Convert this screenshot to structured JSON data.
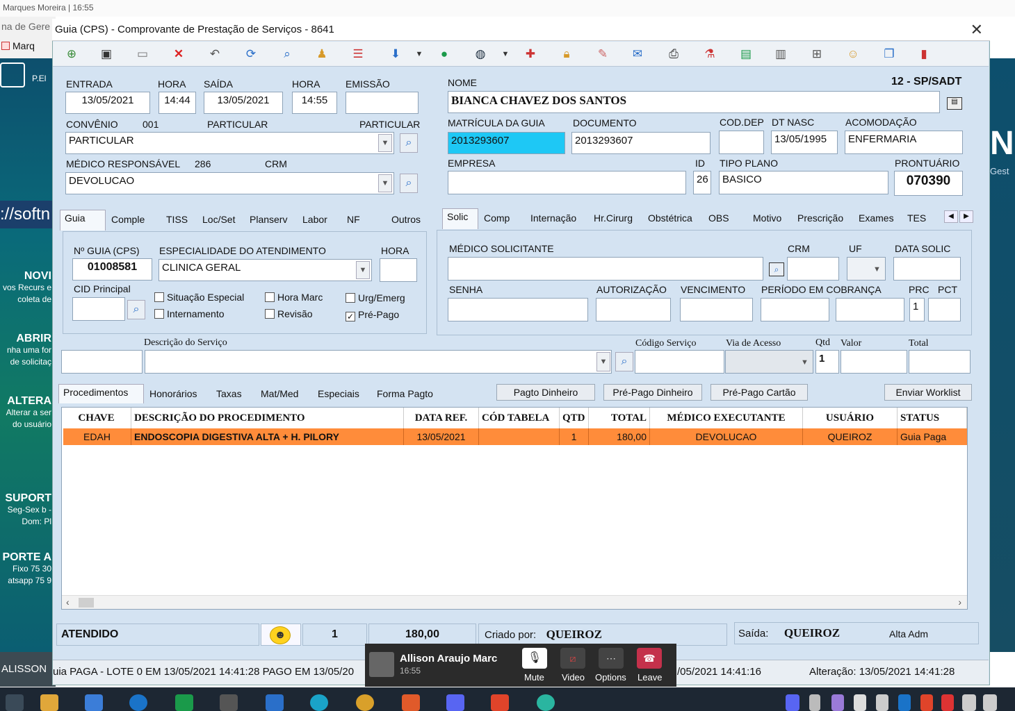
{
  "desktop": {
    "top_text": "Marques Moreira | 16:55",
    "bg_window_title": "na de Gere",
    "bg_window_tab": "Marq",
    "bg_label": "P.El",
    "bg_url": "://softn",
    "promos": [
      {
        "title": "NOVI",
        "sub": "vos Recurs e coleta de"
      },
      {
        "title": "ABRIR",
        "sub": "nha uma for de solicitaç"
      },
      {
        "title": "ALTERA",
        "sub": "Alterar a ser do usuário"
      },
      {
        "title": "SUPORT",
        "sub": "Seg-Sex b - Dom: Pl"
      },
      {
        "title": "PORTE A",
        "sub": "Fixo 75 30 atsapp 75 9"
      }
    ],
    "right_letters": "Ne",
    "right_sub": "Gest",
    "bottom_left": "ALISSON"
  },
  "window": {
    "title": "Guia (CPS) - Comprovante de Prestação de Serviços - 8641",
    "close": "✕"
  },
  "form": {
    "entrada_label": "ENTRADA",
    "entrada": "13/05/2021",
    "hora_label": "HORA",
    "hora": "14:44",
    "saida_label": "SAÍDA",
    "saida": "13/05/2021",
    "hora2_label": "HORA",
    "hora2": "14:55",
    "emissao_label": "EMISSÃO",
    "emissao": "",
    "convenio_label": "CONVÊNIO",
    "convenio_code": "001",
    "convenio_name": "PARTICULAR",
    "convenio_type": "PARTICULAR",
    "convenio": "PARTICULAR",
    "medico_label": "MÉDICO RESPONSÁVEL",
    "medico_code": "286",
    "crm_label": "CRM",
    "medico": "DEVOLUCAO",
    "nome_label": "NOME",
    "guia_type": "12 - SP/SADT",
    "nome": "BIANCA CHAVEZ DOS SANTOS",
    "matricula_label": "MATRÍCULA DA GUIA",
    "matricula": "2013293607",
    "documento_label": "DOCUMENTO",
    "documento": "2013293607",
    "coddep_label": "COD.DEP",
    "coddep": "",
    "dtnasc_label": "DT NASC",
    "dtnasc": "13/05/1995",
    "acomodacao_label": "ACOMODAÇÃO",
    "acomodacao": "ENFERMARIA",
    "empresa_label": "EMPRESA",
    "empresa": "",
    "id_label": "ID",
    "id": "26",
    "tipoplano_label": "TIPO PLANO",
    "tipoplano": "BASICO",
    "prontuario_label": "PRONTUÁRIO",
    "prontuario": "070390"
  },
  "left_tabs": [
    "Guia",
    "Comple",
    "TISS",
    "Loc/Set",
    "Planserv",
    "Labor",
    "NF",
    "Outros"
  ],
  "guia_tab": {
    "nguia_label": "Nº GUIA (CPS)",
    "nguia": "01008581",
    "especialidade_label": "ESPECIALIDADE DO ATENDIMENTO",
    "especialidade": "CLINICA GERAL",
    "hora_label": "HORA",
    "hora": "",
    "cid_label": "CID Principal",
    "checks": [
      {
        "label": "Situação Especial",
        "checked": false
      },
      {
        "label": "Hora Marc",
        "checked": false
      },
      {
        "label": "Urg/Emerg",
        "checked": false
      },
      {
        "label": "Internamento",
        "checked": false
      },
      {
        "label": "Revisão",
        "checked": false
      },
      {
        "label": "Pré-Pago",
        "checked": true
      }
    ]
  },
  "right_tabs": [
    "Solic",
    "Comp",
    "Internação",
    "Hr.Cirurg",
    "Obstétrica",
    "OBS",
    "Motivo",
    "Prescrição",
    "Exames",
    "TES"
  ],
  "solic_tab": {
    "medico_sol_label": "MÉDICO SOLICITANTE",
    "crm_label": "CRM",
    "uf_label": "UF",
    "data_solic_label": "DATA SOLIC",
    "senha_label": "SENHA",
    "autorizacao_label": "AUTORIZAÇÃO",
    "vencimento_label": "VENCIMENTO",
    "periodo_label": "PERÍODO EM COBRANÇA",
    "prc_label": "PRC",
    "pct_label": "PCT",
    "prc": "1"
  },
  "service": {
    "descricao_label": "Descrição do Serviço",
    "codigo_label": "Código Serviço",
    "via_label": "Via de Acesso",
    "qtd_label": "Qtd",
    "valor_label": "Valor",
    "total_label": "Total",
    "qtd": "1"
  },
  "proc_tabs": [
    "Procedimentos",
    "Honorários",
    "Taxas",
    "Mat/Med",
    "Especiais",
    "Forma Pagto"
  ],
  "buttons": {
    "pagto_dinheiro": "Pagto Dinheiro",
    "prepago_dinheiro": "Pré-Pago Dinheiro",
    "prepago_cartao": "Pré-Pago Cartão",
    "enviar_worklist": "Enviar Worklist"
  },
  "grid": {
    "headers": [
      "CHAVE",
      "DESCRIÇÃO DO PROCEDIMENTO",
      "DATA REF.",
      "CÓD TABELA",
      "QTD",
      "TOTAL",
      "MÉDICO EXECUTANTE",
      "USUÁRIO",
      "STATUS"
    ],
    "rows": [
      [
        "EDAH",
        "ENDOSCOPIA DIGESTIVA ALTA + H. PILORY",
        "13/05/2021",
        "",
        "1",
        "180,00",
        "DEVOLUCAO",
        "QUEIROZ",
        "Guia Paga"
      ]
    ]
  },
  "status": {
    "state": "ATENDIDO",
    "count": "1",
    "total": "180,00",
    "criado_label": "Criado por:",
    "criado_by": "QUEIROZ",
    "saida_label": "Saída:",
    "saida_by": "QUEIROZ",
    "alta": "Alta Adm",
    "footer_left": "uia PAGA - LOTE 0 EM 13/05/2021 14:41:28 PAGO EM 13/05/20",
    "footer_mid": "/05/2021 14:41:16",
    "footer_right": "Alteração: 13/05/2021 14:41:28"
  },
  "teams": {
    "name": "Allison Araujo Marc",
    "time": "16:55",
    "mute": "Mute",
    "video": "Video",
    "options": "Options",
    "leave": "Leave"
  },
  "colors": {
    "window_bg": "#d4e3f2",
    "row_highlight": "#ff8c3a",
    "matricula_bg": "#1ec8f5",
    "leave_red": "#c4314b"
  }
}
